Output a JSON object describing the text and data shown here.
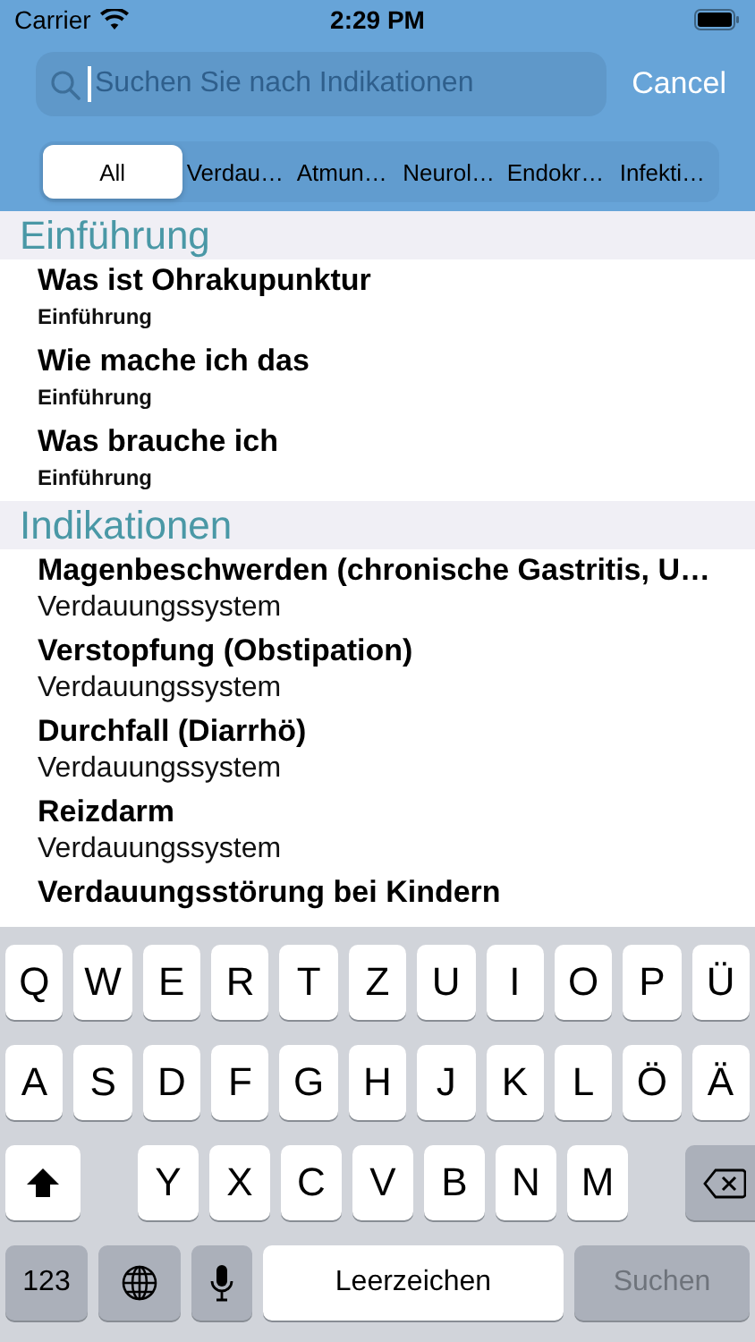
{
  "status_bar": {
    "carrier": "Carrier",
    "time": "2:29 PM"
  },
  "search": {
    "placeholder": "Suchen Sie nach Indikationen",
    "cancel": "Cancel"
  },
  "segments": [
    {
      "label": "All",
      "selected": true
    },
    {
      "label": "Verdau…",
      "selected": false
    },
    {
      "label": "Atmun…",
      "selected": false
    },
    {
      "label": "Neurol…",
      "selected": false
    },
    {
      "label": "Endokr…",
      "selected": false
    },
    {
      "label": "Infekti…",
      "selected": false
    }
  ],
  "sections": [
    {
      "title": "Einführung",
      "kind": "intro",
      "rows": [
        {
          "title": "Was ist Ohrakupunktur",
          "subtitle": "Einführung"
        },
        {
          "title": "Wie mache ich das",
          "subtitle": "Einführung"
        },
        {
          "title": "Was brauche ich",
          "subtitle": "Einführung"
        }
      ]
    },
    {
      "title": "Indikationen",
      "kind": "indication",
      "rows": [
        {
          "title": "Magenbeschwerden (chronische Gastritis, U…",
          "subtitle": "Verdauungssystem"
        },
        {
          "title": "Verstopfung (Obstipation)",
          "subtitle": "Verdauungssystem"
        },
        {
          "title": "Durchfall (Diarrhö)",
          "subtitle": "Verdauungssystem"
        },
        {
          "title": "Reizdarm",
          "subtitle": "Verdauungssystem"
        },
        {
          "title": "Verdauungsstörung bei Kindern"
        }
      ]
    }
  ],
  "keyboard": {
    "rows": [
      {
        "keys": [
          {
            "kind": "letter",
            "label": "Q"
          },
          {
            "kind": "letter",
            "label": "W"
          },
          {
            "kind": "letter",
            "label": "E"
          },
          {
            "kind": "letter",
            "label": "R"
          },
          {
            "kind": "letter",
            "label": "T"
          },
          {
            "kind": "letter",
            "label": "Z"
          },
          {
            "kind": "letter",
            "label": "U"
          },
          {
            "kind": "letter",
            "label": "I"
          },
          {
            "kind": "letter",
            "label": "O"
          },
          {
            "kind": "letter",
            "label": "P"
          },
          {
            "kind": "letter",
            "label": "Ü"
          }
        ]
      },
      {
        "keys": [
          {
            "kind": "letter",
            "label": "A"
          },
          {
            "kind": "letter",
            "label": "S"
          },
          {
            "kind": "letter",
            "label": "D"
          },
          {
            "kind": "letter",
            "label": "F"
          },
          {
            "kind": "letter",
            "label": "G"
          },
          {
            "kind": "letter",
            "label": "H"
          },
          {
            "kind": "letter",
            "label": "J"
          },
          {
            "kind": "letter",
            "label": "K"
          },
          {
            "kind": "letter",
            "label": "L"
          },
          {
            "kind": "letter",
            "label": "Ö"
          },
          {
            "kind": "letter",
            "label": "Ä"
          }
        ]
      },
      {
        "keys": [
          {
            "kind": "shift"
          },
          {
            "kind": "letter",
            "label": "Y"
          },
          {
            "kind": "letter",
            "label": "X"
          },
          {
            "kind": "letter",
            "label": "C"
          },
          {
            "kind": "letter",
            "label": "V"
          },
          {
            "kind": "letter",
            "label": "B"
          },
          {
            "kind": "letter",
            "label": "N"
          },
          {
            "kind": "letter",
            "label": "M"
          },
          {
            "kind": "delete"
          }
        ]
      },
      {
        "keys": [
          {
            "kind": "mode",
            "label": "123"
          },
          {
            "kind": "globe"
          },
          {
            "kind": "mic"
          },
          {
            "kind": "space",
            "label": "Leerzeichen"
          },
          {
            "kind": "search",
            "label": "Suchen",
            "disabled": true
          }
        ]
      }
    ]
  }
}
